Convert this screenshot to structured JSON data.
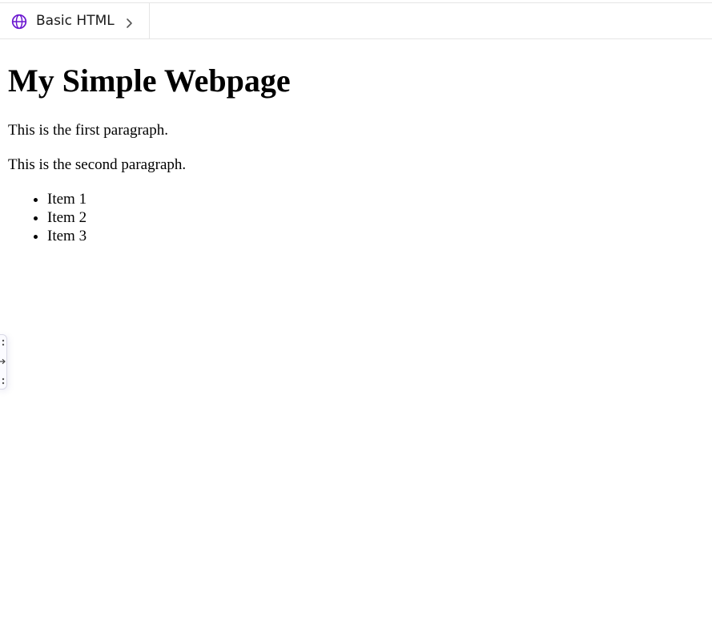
{
  "tab": {
    "label": "Basic HTML",
    "icon": "globe-icon",
    "chevron_icon": "chevron-right-icon",
    "accent_color": "#6b17d0"
  },
  "document": {
    "title": "My Simple Webpage",
    "paragraphs": [
      "This is the first paragraph.",
      "This is the second paragraph."
    ],
    "list_items": [
      "Item 1",
      "Item 2",
      "Item 3"
    ]
  },
  "side_handle": {
    "icons": [
      "drag-dots-icon",
      "arrow-right-icon",
      "drag-dots-icon"
    ]
  }
}
